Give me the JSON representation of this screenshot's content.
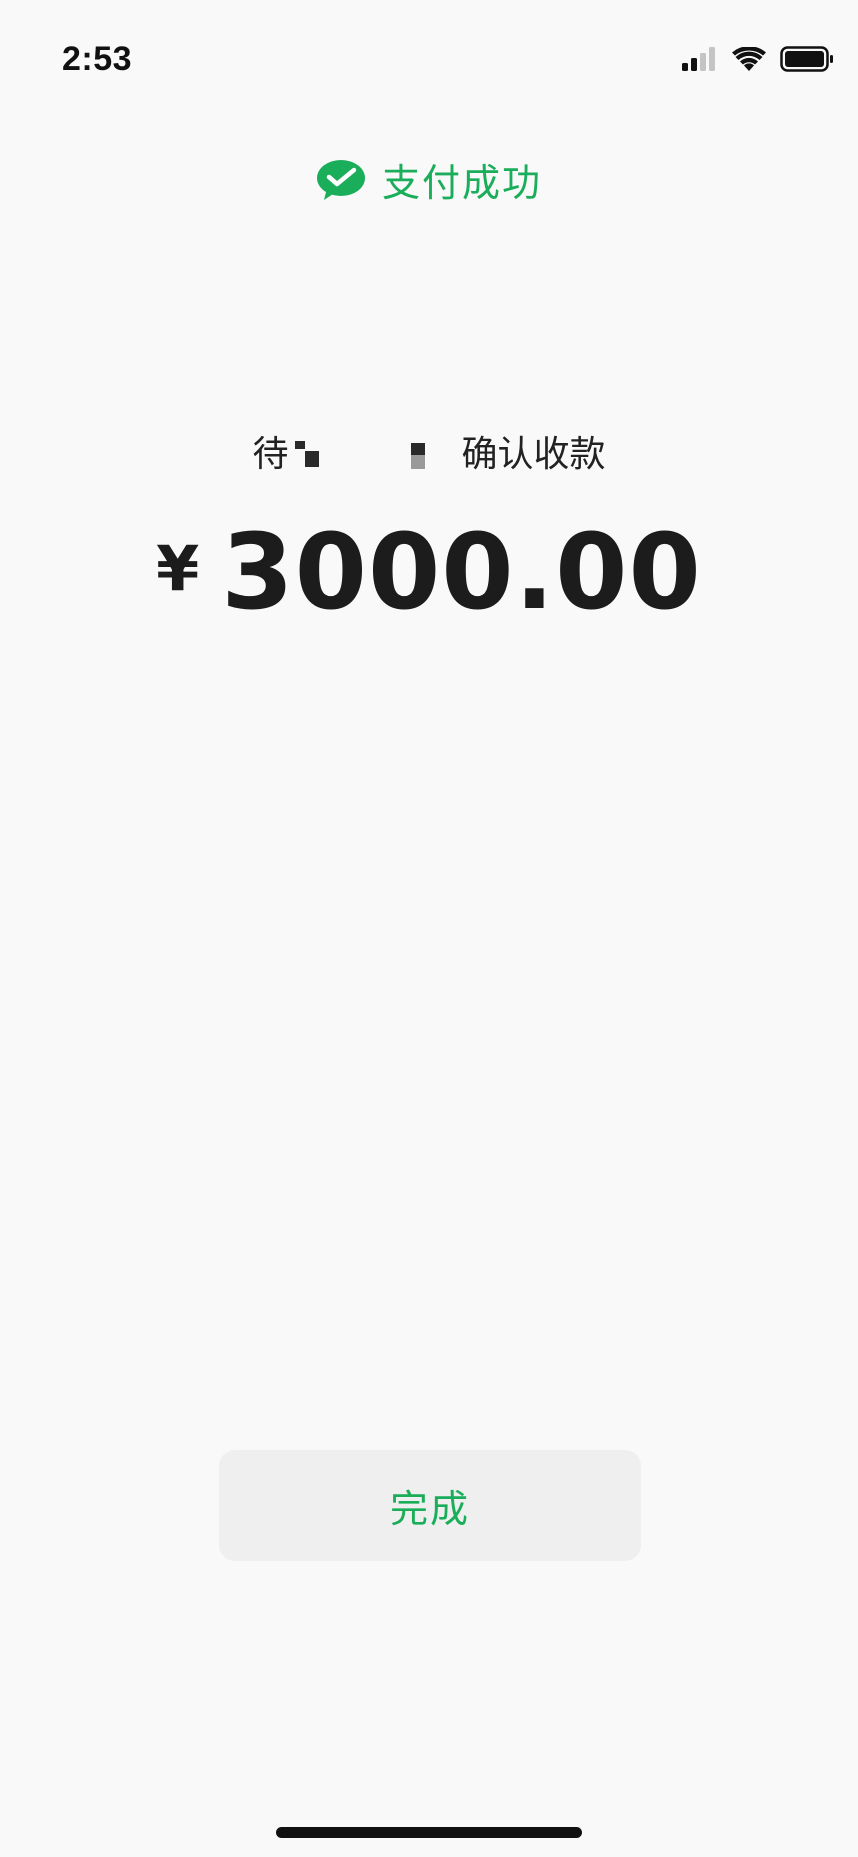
{
  "status_bar": {
    "time": "2:53",
    "signal_icon": "cellular-signal-icon",
    "wifi_icon": "wifi-icon",
    "battery_icon": "battery-icon"
  },
  "header": {
    "icon": "wechat-pay-check-icon",
    "title": "支付成功",
    "accent_color": "#1aad5a"
  },
  "payee": {
    "prefix": "待",
    "suffix": "确认收款"
  },
  "amount": {
    "currency_symbol": "¥",
    "value": "3000.00"
  },
  "actions": {
    "done_label": "完成"
  }
}
